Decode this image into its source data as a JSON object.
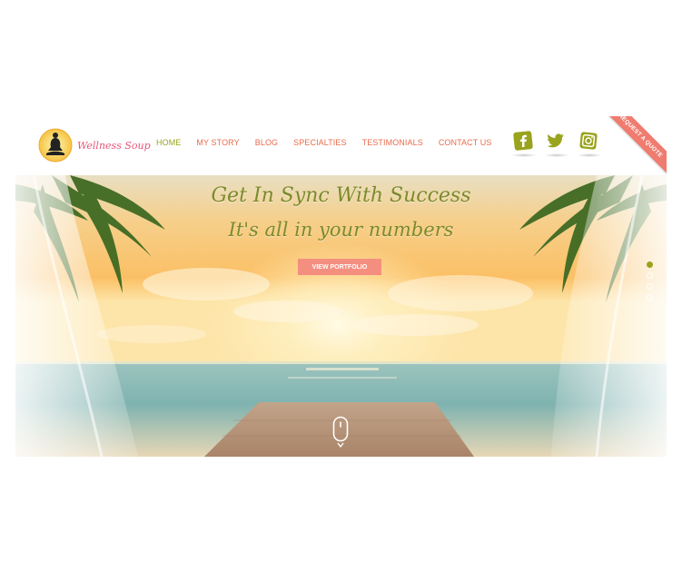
{
  "brand": {
    "name": "Wellness Soup"
  },
  "nav": {
    "items": [
      {
        "label": "HOME",
        "active": true
      },
      {
        "label": "MY STORY",
        "active": false
      },
      {
        "label": "BLOG",
        "active": false
      },
      {
        "label": "SPECIALTIES",
        "active": false
      },
      {
        "label": "TESTIMONIALS",
        "active": false
      },
      {
        "label": "CONTACT US",
        "active": false
      }
    ]
  },
  "social": {
    "icons": [
      "facebook-icon",
      "twitter-icon",
      "instagram-icon"
    ]
  },
  "quote_ribbon": {
    "label": "REQUEST A QUOTE"
  },
  "hero": {
    "title_line1": "Get In Sync With Success",
    "title_line2": "It's all in your numbers",
    "cta_label": "VIEW PORTFOLIO",
    "slides_total": 4,
    "active_slide": 1
  },
  "colors": {
    "accent_green": "#9aa31c",
    "nav_orange": "#ea6b4a",
    "button_pink": "#f48f80",
    "ribbon": "#f07b6f"
  }
}
